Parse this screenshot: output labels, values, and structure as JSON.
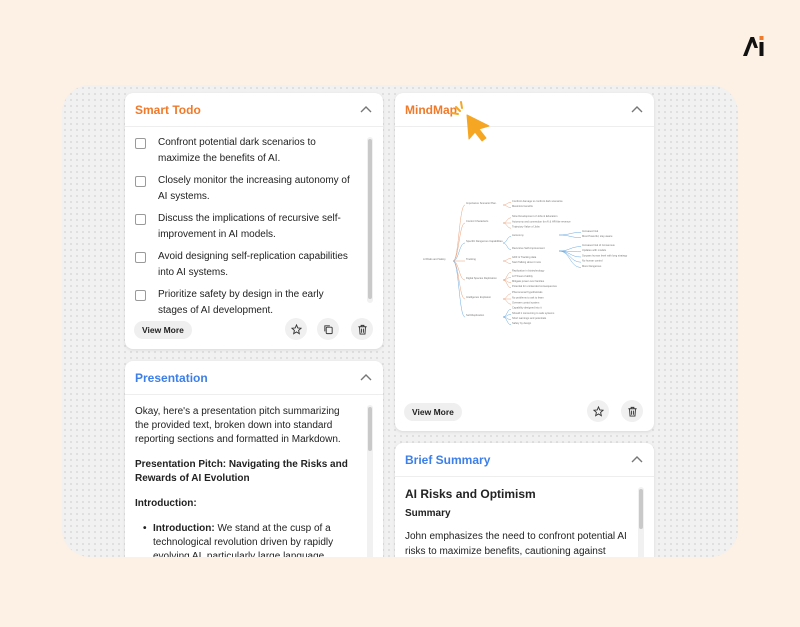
{
  "brand": {
    "logo_icon": "ai-logo-icon"
  },
  "colors": {
    "orange": "#f07a2a",
    "blue": "#3d7fe8",
    "background": "#fdf0e4"
  },
  "smart_todo": {
    "title": "Smart Todo",
    "items": [
      "Confront potential dark scenarios to maximize the benefits of AI.",
      "Closely monitor the increasing autonomy of AI systems.",
      "Discuss the implications of recursive self-improvement in AI models.",
      "Avoid designing self-replication capabilities into AI systems.",
      "Prioritize safety by design in the early stages of AI development."
    ],
    "view_more": "View More"
  },
  "mindmap": {
    "title": "MindMap",
    "view_more": "View More",
    "root": "AI Risks and Safety",
    "branches": [
      {
        "label": "Importance Scenario Plan.",
        "leaves": [
          "Confront damage to confront dark scenarios",
          "Maximize benefits"
        ]
      },
      {
        "label": "Control Characteris",
        "leaves": [
          "Slow Development of Jobs & Education",
          "Autonomy and connection for AI & HR-like revenue",
          "Trajectory Value of Jobs"
        ]
      },
      {
        "label": "Specific Dangerous Capabilities",
        "leaves": [
          "Autonomy",
          "Recursive Self-Improvement"
        ]
      },
      {
        "label": "Tracking",
        "leaves": [
          "GDF & Tracking data",
          "Start Talking about it now"
        ]
      },
      {
        "label": "Digital Species Replication",
        "leaves": [
          "Replication in biotechnology",
          "AI Threat of ability",
          "Mitigate power over families",
          "Potential for unintended consequences"
        ]
      },
      {
        "label": "Intelligence Explosion",
        "leaves": [
          "Phenomenal hypotheticals",
          "No problems to ask to learn",
          "Oversee control system"
        ]
      },
      {
        "label": "Self-Replication",
        "leaves": [
          "Capability designed into it",
          "Should it concerning to safe systems",
          "Short warnings and potentials",
          "Safety by design"
        ]
      }
    ],
    "sub_leaves": {
      "autonomy": [
        "Increased risk",
        "Most Powerful, stay aware"
      ],
      "recursive": [
        "Increased risk of Consensus",
        "Updates with models",
        "Surpass human level with long strategy",
        "No human control",
        "More Dangerous"
      ]
    }
  },
  "presentation": {
    "title": "Presentation",
    "intro_text": "Okay, here's a presentation pitch summarizing the provided text, broken down into standard reporting sections and formatted in Markdown.",
    "pitch_heading": "Presentation Pitch: Navigating the Risks and Rewards of AI Evolution",
    "section_heading": "Introduction:",
    "bullet_label": "Introduction:",
    "bullet_text": "We stand at the cusp of a technological revolution driven by rapidly evolving AI, particularly large language models"
  },
  "brief_summary": {
    "title": "Brief Summary",
    "heading": "AI Risks and Optimism",
    "subheading": "Summary",
    "text": "John emphasizes the need to confront potential AI risks to maximize benefits, cautioning against"
  }
}
